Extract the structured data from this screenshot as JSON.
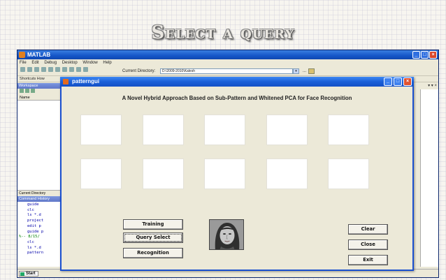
{
  "slide": {
    "title": "Select a query"
  },
  "matlab": {
    "title": "MATLAB",
    "menu": [
      "File",
      "Edit",
      "Debug",
      "Desktop",
      "Window",
      "Help"
    ],
    "current_directory_label": "Current Directory:",
    "current_directory_value": "D:\\2009-2010\\Kalesh",
    "shortcuts_label": "Shortcuts",
    "how_to_add": "How",
    "workspace_label": "Workspace",
    "name_column": "Name",
    "current_directory_tab": "Current Directory",
    "command_history_label": "Command History",
    "command_history": [
      {
        "text": "guide",
        "session": false
      },
      {
        "text": "clc",
        "session": false
      },
      {
        "text": "ls *.d",
        "session": false
      },
      {
        "text": "project",
        "session": false
      },
      {
        "text": "edit p",
        "session": false
      },
      {
        "text": "guide p",
        "session": false
      },
      {
        "text": "%-- 8/15/",
        "session": true
      },
      {
        "text": "clc",
        "session": false
      },
      {
        "text": "ls *.d",
        "session": false
      },
      {
        "text": "pattern",
        "session": false
      }
    ],
    "start_label": "Start"
  },
  "gui": {
    "title": "patterngui",
    "heading": "A Novel Hybrid Approach Based on Sub-Pattern and Whitened PCA for Face Recognition",
    "buttons": {
      "training": "Training",
      "query_select": "Query Select",
      "recognition": "Recognition",
      "clear": "Clear",
      "close": "Close",
      "exit": "Exit"
    }
  }
}
